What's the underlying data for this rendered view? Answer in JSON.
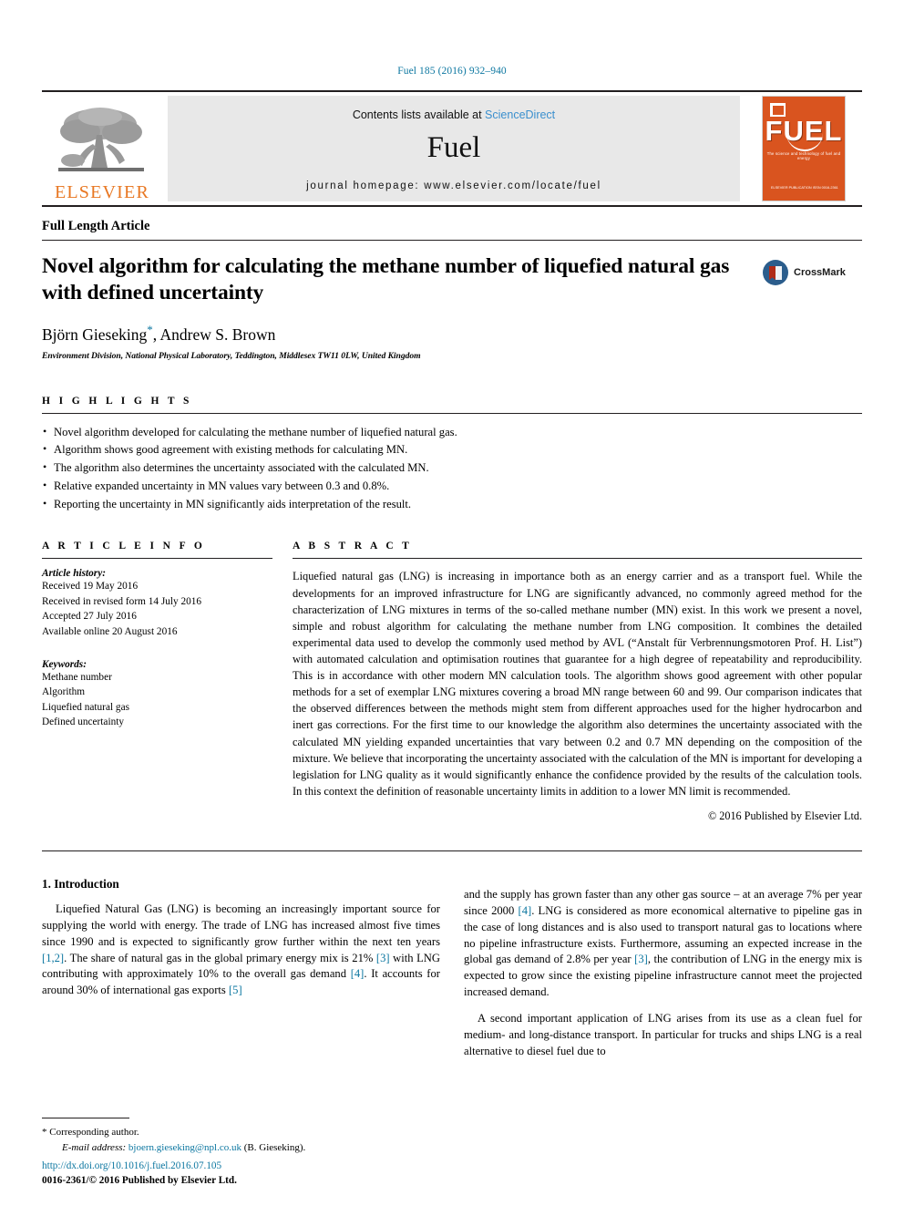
{
  "running_head": "Fuel 185 (2016) 932–940",
  "masthead": {
    "publisher_name": "ELSEVIER",
    "contents_prefix": "Contents lists available at ",
    "contents_link": "ScienceDirect",
    "journal_name": "Fuel",
    "homepage": "journal homepage: www.elsevier.com/locate/fuel",
    "cover": {
      "title": "FUEL",
      "subtitle": "The science and technology of fuel and energy",
      "footer": "ELSEVIER PUBLICATION\nISSN 0016-2361"
    }
  },
  "article_type": "Full Length Article",
  "title": "Novel algorithm for calculating the methane number of liquefied natural gas with defined uncertainty",
  "authors": "Björn Gieseking",
  "authors_rest": ", Andrew S. Brown",
  "corresponding_marker": "*",
  "affiliation": "Environment Division, National Physical Laboratory, Teddington, Middlesex TW11 0LW, United Kingdom",
  "crossmark_label": "CrossMark",
  "highlights": {
    "heading": "H I G H L I G H T S",
    "items": [
      "Novel algorithm developed for calculating the methane number of liquefied natural gas.",
      "Algorithm shows good agreement with existing methods for calculating MN.",
      "The algorithm also determines the uncertainty associated with the calculated MN.",
      "Relative expanded uncertainty in MN values vary between 0.3 and 0.8%.",
      "Reporting the uncertainty in MN significantly aids interpretation of the result."
    ]
  },
  "article_info": {
    "heading": "A R T I C L E   I N F O",
    "history_label": "Article history:",
    "history": [
      "Received 19 May 2016",
      "Received in revised form 14 July 2016",
      "Accepted 27 July 2016",
      "Available online 20 August 2016"
    ],
    "keywords_label": "Keywords:",
    "keywords": [
      "Methane number",
      "Algorithm",
      "Liquefied natural gas",
      "Defined uncertainty"
    ]
  },
  "abstract": {
    "heading": "A B S T R A C T",
    "text": "Liquefied natural gas (LNG) is increasing in importance both as an energy carrier and as a transport fuel. While the developments for an improved infrastructure for LNG are significantly advanced, no commonly agreed method for the characterization of LNG mixtures in terms of the so-called methane number (MN) exist. In this work we present a novel, simple and robust algorithm for calculating the methane number from LNG composition. It combines the detailed experimental data used to develop the commonly used method by AVL (“Anstalt für Verbrennungsmotoren Prof. H. List”) with automated calculation and optimisation routines that guarantee for a high degree of repeatability and reproducibility. This is in accordance with other modern MN calculation tools. The algorithm shows good agreement with other popular methods for a set of exemplar LNG mixtures covering a broad MN range between 60 and 99. Our comparison indicates that the observed differences between the methods might stem from different approaches used for the higher hydrocarbon and inert gas corrections. For the first time to our knowledge the algorithm also determines the uncertainty associated with the calculated MN yielding expanded uncertainties that vary between 0.2 and 0.7 MN depending on the composition of the mixture. We believe that incorporating the uncertainty associated with the calculation of the MN is important for developing a legislation for LNG quality as it would significantly enhance the confidence provided by the results of the calculation tools. In this context the definition of reasonable uncertainty limits in addition to a lower MN limit is recommended.",
    "copyright": "© 2016 Published by Elsevier Ltd."
  },
  "body": {
    "section_heading": "1. Introduction",
    "left_p1_a": "Liquefied Natural Gas (LNG) is becoming an increasingly important source for supplying the world with energy. The trade of LNG has increased almost five times since 1990 and is expected to significantly grow further within the next ten years ",
    "left_ref_12": "[1,2]",
    "left_p1_b": ". The share of natural gas in the global primary energy mix is 21% ",
    "left_ref_3": "[3]",
    "left_p1_c": " with LNG contributing with approximately 10% to the overall gas demand ",
    "left_ref_4": "[4]",
    "left_p1_d": ". It accounts for around 30% of international gas exports ",
    "left_ref_5": "[5]",
    "right_p1_a": "and the supply has grown faster than any other gas source – at an average 7% per year since 2000 ",
    "right_ref_4": "[4]",
    "right_p1_b": ". LNG is considered as more economical alternative to pipeline gas in the case of long distances and is also used to transport natural gas to locations where no pipeline infrastructure exists. Furthermore, assuming an expected increase in the global gas demand of 2.8% per year ",
    "right_ref_3": "[3]",
    "right_p1_c": ", the contribution of LNG in the energy mix is expected to grow since the existing pipeline infrastructure cannot meet the projected increased demand.",
    "right_p2": "A second important application of LNG arises from its use as a clean fuel for medium- and long-distance transport. In particular for trucks and ships LNG is a real alternative to diesel fuel due to"
  },
  "footnotes": {
    "corresponding": "Corresponding author.",
    "email_label": "E-mail address:",
    "email": "bjoern.gieseking@npl.co.uk",
    "email_owner": "(B. Gieseking).",
    "doi": "http://dx.doi.org/10.1016/j.fuel.2016.07.105",
    "issn": "0016-2361/© 2016 Published by Elsevier Ltd."
  },
  "colors": {
    "link": "#0b76a0",
    "elsevier_orange": "#e87722",
    "cover_orange": "#d9541f",
    "banner_grey": "#e8e8e8"
  }
}
